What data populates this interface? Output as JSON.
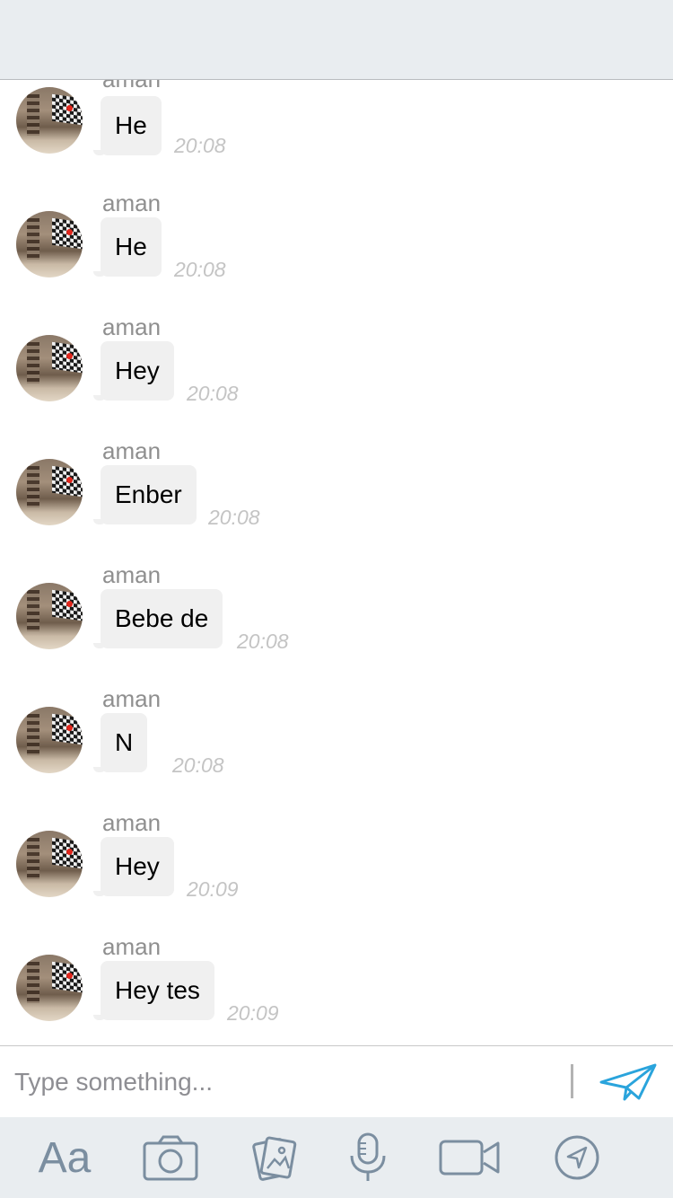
{
  "messages": [
    {
      "sender": "aman",
      "text": "He",
      "time": "20:08"
    },
    {
      "sender": "aman",
      "text": "He",
      "time": "20:08"
    },
    {
      "sender": "aman",
      "text": "Hey",
      "time": "20:08"
    },
    {
      "sender": "aman",
      "text": "Enber",
      "time": "20:08"
    },
    {
      "sender": "aman",
      "text": "Bebe de",
      "time": "20:08"
    },
    {
      "sender": "aman",
      "text": "N",
      "time": "20:08"
    },
    {
      "sender": "aman",
      "text": "Hey",
      "time": "20:09"
    },
    {
      "sender": "aman",
      "text": "Hey tes",
      "time": "20:09"
    }
  ],
  "composer": {
    "placeholder": "Type something..."
  },
  "toolbar": {
    "text_label": "Aa"
  },
  "colors": {
    "accent": "#2aa4dc",
    "icon": "#7b8ea0",
    "bar_bg": "#e9edf0",
    "bubble": "#f0f0f0"
  }
}
